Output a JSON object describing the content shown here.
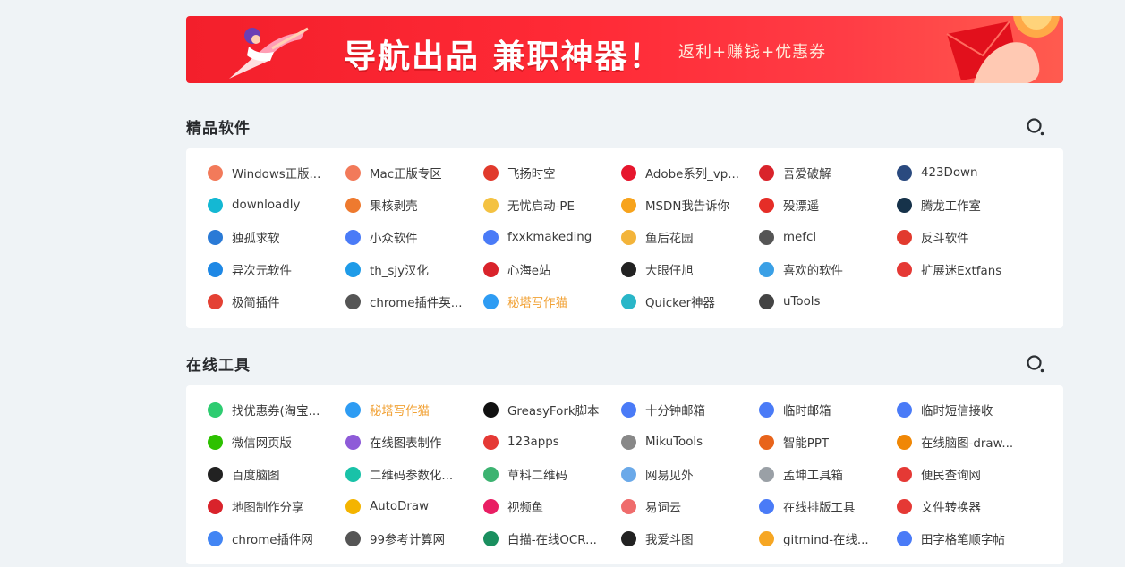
{
  "banner": {
    "title": "导航出品 兼职神器！",
    "subtitle": "返利+赚钱+优惠券"
  },
  "sections": [
    {
      "title": "精品软件",
      "items": [
        {
          "label": "Windows正版...",
          "icon": "peach-icon",
          "color": "#f27a5a"
        },
        {
          "label": "Mac正版专区",
          "icon": "peach-icon",
          "color": "#f27a5a"
        },
        {
          "label": "飞扬时空",
          "icon": "colorful-flower-icon",
          "color": "#e13a2c"
        },
        {
          "label": "Adobe系列_vp...",
          "icon": "weibo-icon",
          "color": "#e6162d"
        },
        {
          "label": "吾爱破解",
          "icon": "52pojie-icon",
          "color": "#d9232b"
        },
        {
          "label": "423Down",
          "icon": "423down-icon",
          "color": "#2a4a7f"
        },
        {
          "label": "downloadly",
          "icon": "play-icon",
          "color": "#14b8d3"
        },
        {
          "label": "果核剥壳",
          "icon": "basketball-icon",
          "color": "#ee7a2f"
        },
        {
          "label": "无忧启动-PE",
          "icon": "egg-icon",
          "color": "#f4c242"
        },
        {
          "label": "MSDN我告诉你",
          "icon": "msdn-icon",
          "color": "#f7a31c"
        },
        {
          "label": "殁漂遥",
          "icon": "spiral-icon",
          "color": "#e52d27"
        },
        {
          "label": "腾龙工作室",
          "icon": "dragon-icon",
          "color": "#16324a"
        },
        {
          "label": "独孤求软",
          "icon": "soft-icon",
          "color": "#2a7ad6"
        },
        {
          "label": "小众软件",
          "icon": "eye-icon",
          "color": "#4a7bf7"
        },
        {
          "label": "fxxkmakeding",
          "icon": "eye-icon",
          "color": "#4a7bf7"
        },
        {
          "label": "鱼后花园",
          "icon": "fish-icon",
          "color": "#f3b43a"
        },
        {
          "label": "mefcl",
          "icon": "heart-icon",
          "color": "#555555"
        },
        {
          "label": "反斗软件",
          "icon": "fandou-icon",
          "color": "#e23a2e"
        },
        {
          "label": "异次元软件",
          "icon": "bowtie-icon",
          "color": "#1e88e5"
        },
        {
          "label": "th_sjy汉化",
          "icon": "t-icon",
          "color": "#1e9be8"
        },
        {
          "label": "心海e站",
          "icon": "heart-sea-icon",
          "color": "#d9232b"
        },
        {
          "label": "大眼仔旭",
          "icon": "bigeye-icon",
          "color": "#222222"
        },
        {
          "label": "喜欢的软件",
          "icon": "drop-icon",
          "color": "#3aa0e6"
        },
        {
          "label": "扩展迷Extfans",
          "icon": "ex-icon",
          "color": "#e53935"
        },
        {
          "label": "极简插件",
          "icon": "chrome-icon",
          "color": "#e44134"
        },
        {
          "label": "chrome插件英...",
          "icon": "book-icon",
          "color": "#555555"
        },
        {
          "label": "秘塔写作猫",
          "icon": "cat-icon",
          "color": "#2e9cf3",
          "highlight": true
        },
        {
          "label": "Quicker神器",
          "icon": "dots-icon",
          "color": "#29b6c8"
        },
        {
          "label": "uTools",
          "icon": "utools-icon",
          "color": "#444444"
        }
      ]
    },
    {
      "title": "在线工具",
      "items": [
        {
          "label": "找优惠券(淘宝...",
          "icon": "leaf-icon",
          "color": "#2ecc71"
        },
        {
          "label": "秘塔写作猫",
          "icon": "cat-icon",
          "color": "#2e9cf3",
          "highlight": true
        },
        {
          "label": "GreasyFork脚本",
          "icon": "greasyfork-icon",
          "color": "#111111"
        },
        {
          "label": "十分钟邮箱",
          "icon": "eye-icon",
          "color": "#4a7bf7"
        },
        {
          "label": "临时邮箱",
          "icon": "eye-icon",
          "color": "#4a7bf7"
        },
        {
          "label": "临时短信接收",
          "icon": "eye-icon",
          "color": "#4a7bf7"
        },
        {
          "label": "微信网页版",
          "icon": "wechat-icon",
          "color": "#2dc100"
        },
        {
          "label": "在线图表制作",
          "icon": "cube-icon",
          "color": "#8e5bd8"
        },
        {
          "label": "123apps",
          "icon": "123-icon",
          "color": "#e53935"
        },
        {
          "label": "MikuTools",
          "icon": "cup-icon",
          "color": "#888888"
        },
        {
          "label": "智能PPT",
          "icon": "ppt-icon",
          "color": "#e8641b"
        },
        {
          "label": "在线脑图-draw...",
          "icon": "drawio-icon",
          "color": "#f08705"
        },
        {
          "label": "百度脑图",
          "icon": "owl-icon",
          "color": "#222222"
        },
        {
          "label": "二维码参数化...",
          "icon": "qr-icon",
          "color": "#19c2a8"
        },
        {
          "label": "草料二维码",
          "icon": "caoliao-icon",
          "color": "#3cb371"
        },
        {
          "label": "网易见外",
          "icon": "wave-icon",
          "color": "#6aa9e9"
        },
        {
          "label": "孟坤工具箱",
          "icon": "toolbox-icon",
          "color": "#9aa0a6"
        },
        {
          "label": "便民查询网",
          "icon": "query-icon",
          "color": "#e53935"
        },
        {
          "label": "地图制作分享",
          "icon": "map-icon",
          "color": "#d9232b"
        },
        {
          "label": "AutoDraw",
          "icon": "pencil-icon",
          "color": "#f4b400"
        },
        {
          "label": "视频鱼",
          "icon": "video-icon",
          "color": "#e91e63"
        },
        {
          "label": "易词云",
          "icon": "y-icon",
          "color": "#ef6c6c"
        },
        {
          "label": "在线排版工具",
          "icon": "eye-icon",
          "color": "#4a7bf7"
        },
        {
          "label": "文件转换器",
          "icon": "convert-icon",
          "color": "#e53935"
        },
        {
          "label": "chrome插件网",
          "icon": "chrome-icon",
          "color": "#4285f4"
        },
        {
          "label": "99参考计算网",
          "icon": "calc-icon",
          "color": "#555555"
        },
        {
          "label": "白描-在线OCR...",
          "icon": "baimiao-icon",
          "color": "#1a8f5f"
        },
        {
          "label": "我爱斗图",
          "icon": "panda-icon",
          "color": "#222222"
        },
        {
          "label": "gitmind-在线...",
          "icon": "gitmind-icon",
          "color": "#f6a623"
        },
        {
          "label": "田字格笔顺字帖",
          "icon": "eye-icon",
          "color": "#4a7bf7"
        }
      ]
    }
  ]
}
